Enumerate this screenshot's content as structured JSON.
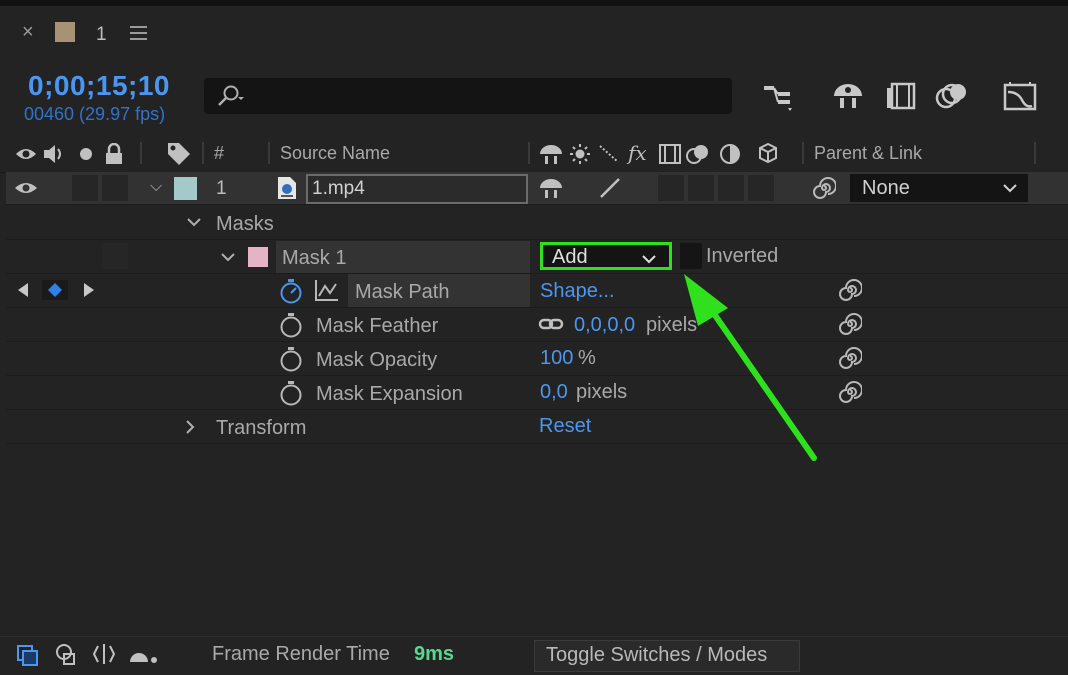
{
  "tab": {
    "close_glyph": "×",
    "name": "1",
    "swatch_color": "#a89275"
  },
  "timecode": {
    "value": "0;00;15;10",
    "frames": "00460 (29.97 fps)"
  },
  "search": {
    "placeholder": ""
  },
  "toolbar": {
    "icons": [
      "composition-flowchart-icon",
      "draft-3d-icon",
      "frame-blending-icon",
      "motion-blur-icon",
      "graph-editor-icon"
    ]
  },
  "columns": {
    "number": "#",
    "source_name": "Source Name",
    "parent_link": "Parent & Link",
    "switch_fx": "fx"
  },
  "layer": {
    "number": "1",
    "name": "1.mp4",
    "label_color": "#a3c9c8",
    "parent_value": "None"
  },
  "masks_group": {
    "label": "Masks"
  },
  "mask": {
    "name": "Mask 1",
    "color": "#e6b3c6",
    "mode": "Add",
    "inverted_label": "Inverted"
  },
  "properties": {
    "mask_path": {
      "label": "Mask Path",
      "value": "Shape..."
    },
    "mask_feather": {
      "label": "Mask Feather",
      "value": "0,0,0,0",
      "unit": "pixels"
    },
    "mask_opacity": {
      "label": "Mask Opacity",
      "value": "100",
      "unit": "%"
    },
    "mask_expansion": {
      "label": "Mask Expansion",
      "value": "0,0",
      "unit": "pixels"
    }
  },
  "transform": {
    "label": "Transform",
    "value": "Reset"
  },
  "footer": {
    "frame_render_label": "Frame Render Time",
    "frame_render_value": "9ms",
    "toggle_label": "Toggle Switches / Modes"
  },
  "colors": {
    "accent_blue": "#4b96f0",
    "highlight_green": "#2fe01c",
    "render_time": "#5ad694"
  }
}
